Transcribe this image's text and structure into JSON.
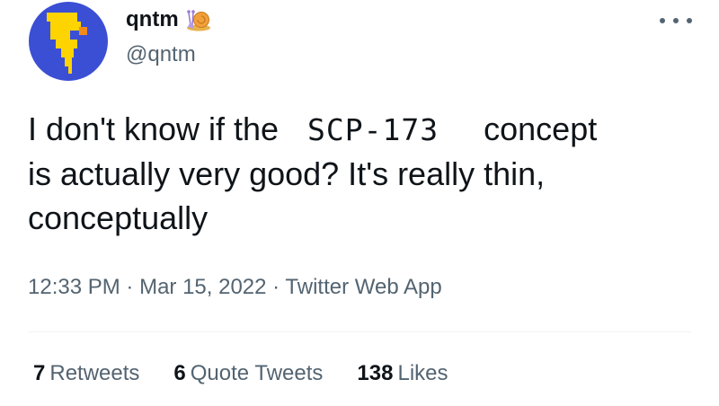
{
  "author": {
    "display_name": "qntm",
    "handle": "@qntm",
    "avatar_icon": "pixel-face-avatar",
    "badge_icon": "snail-emoji"
  },
  "menu": {
    "more_icon": "ellipsis-icon"
  },
  "tweet": {
    "text_before": "I don't know if the",
    "scp_term": "SCP-173",
    "text_after_term": "concept",
    "line2": "is actually very good? It's really thin,",
    "line3": "conceptually"
  },
  "meta": {
    "time": "12:33 PM",
    "separator": "·",
    "date": "Mar 15, 2022",
    "source": "Twitter Web App"
  },
  "stats": {
    "retweets_count": "7",
    "retweets_label": "Retweets",
    "quotes_count": "6",
    "quotes_label": "Quote Tweets",
    "likes_count": "138",
    "likes_label": "Likes"
  },
  "colors": {
    "avatar_bg": "#3b4fd4",
    "avatar_accent": "#fdd300",
    "secondary_text": "#536471",
    "primary_text": "#0f1419"
  }
}
